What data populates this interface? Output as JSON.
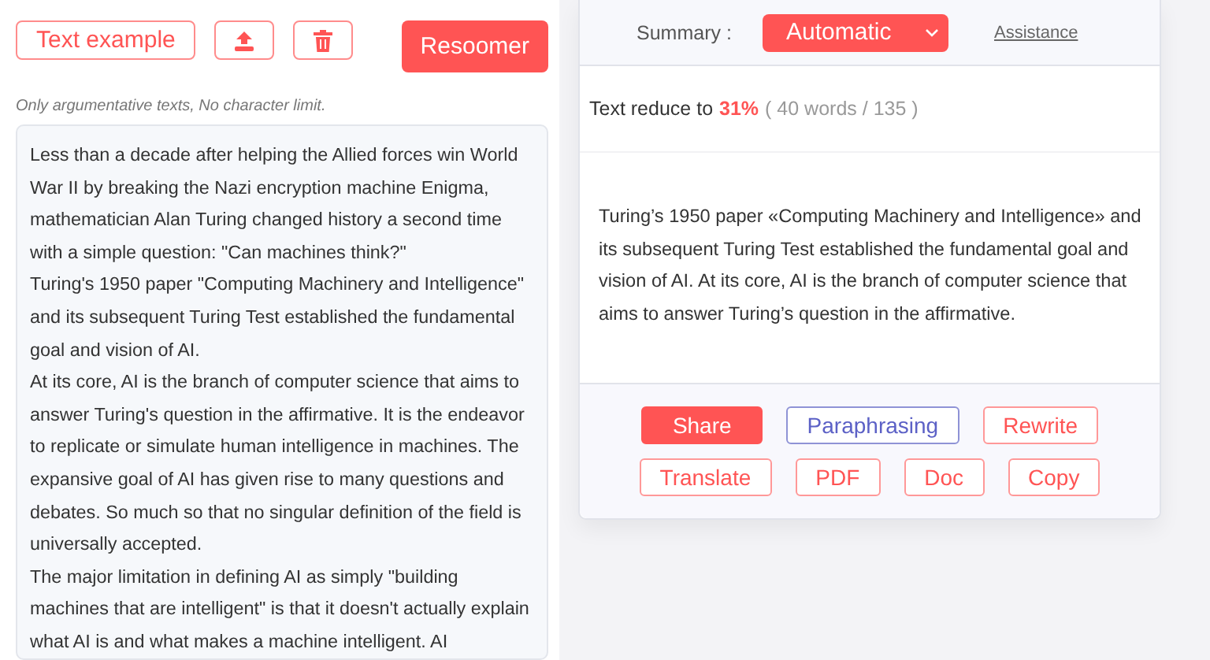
{
  "toolbar": {
    "buttons": [
      {
        "kind": "text",
        "label": "Text example"
      },
      {
        "kind": "upload"
      },
      {
        "kind": "trash"
      }
    ],
    "submit": "Resoomer"
  },
  "hint": "Only argumentative texts, No character limit.",
  "input_text": [
    "Less than a decade after helping the Allied forces win World War II by breaking the Nazi encryption machine Enigma, mathematician Alan Turing changed history a second time with a simple question: \"Can machines think?\"",
    "Turing's 1950 paper \"Computing Machinery and Intelligence\" and its subsequent Turing Test established the fundamental goal and vision of AI.",
    "At its core, AI is the branch of computer science that aims to answer Turing's question in the affirmative. It is the endeavor to replicate or simulate human intelligence in machines. The expansive goal of AI has given rise to many questions and debates. So much so that no singular definition of the field is universally accepted.",
    "The major limitation in defining AI as simply \"building machines that are intelligent\" is that it doesn't actually explain what AI is and what makes a machine intelligent. AI"
  ],
  "summary": {
    "label": "Summary :",
    "mode": "Automatic",
    "help_link": "Assistance",
    "reduce_label": "Text reduce to",
    "percent": "31%",
    "counts": "( 40 words / 135 )",
    "text": "Turing’s 1950 paper «Computing Machinery and Intelligence» and its subsequent Turing Test established the fundamental goal and vision of AI. At its core, AI is the branch of computer science that aims to answer Turing’s question in the affirmative."
  },
  "actions": [
    [
      {
        "kind": "primary",
        "label": "Share"
      },
      {
        "kind": "secondary",
        "label": "Paraphrasing"
      },
      {
        "kind": "outline",
        "label": "Rewrite"
      }
    ],
    [
      {
        "kind": "outline",
        "label": "Translate"
      },
      {
        "kind": "outline",
        "label": "PDF"
      },
      {
        "kind": "outline",
        "label": "Doc"
      },
      {
        "kind": "outline",
        "label": "Copy"
      }
    ]
  ]
}
